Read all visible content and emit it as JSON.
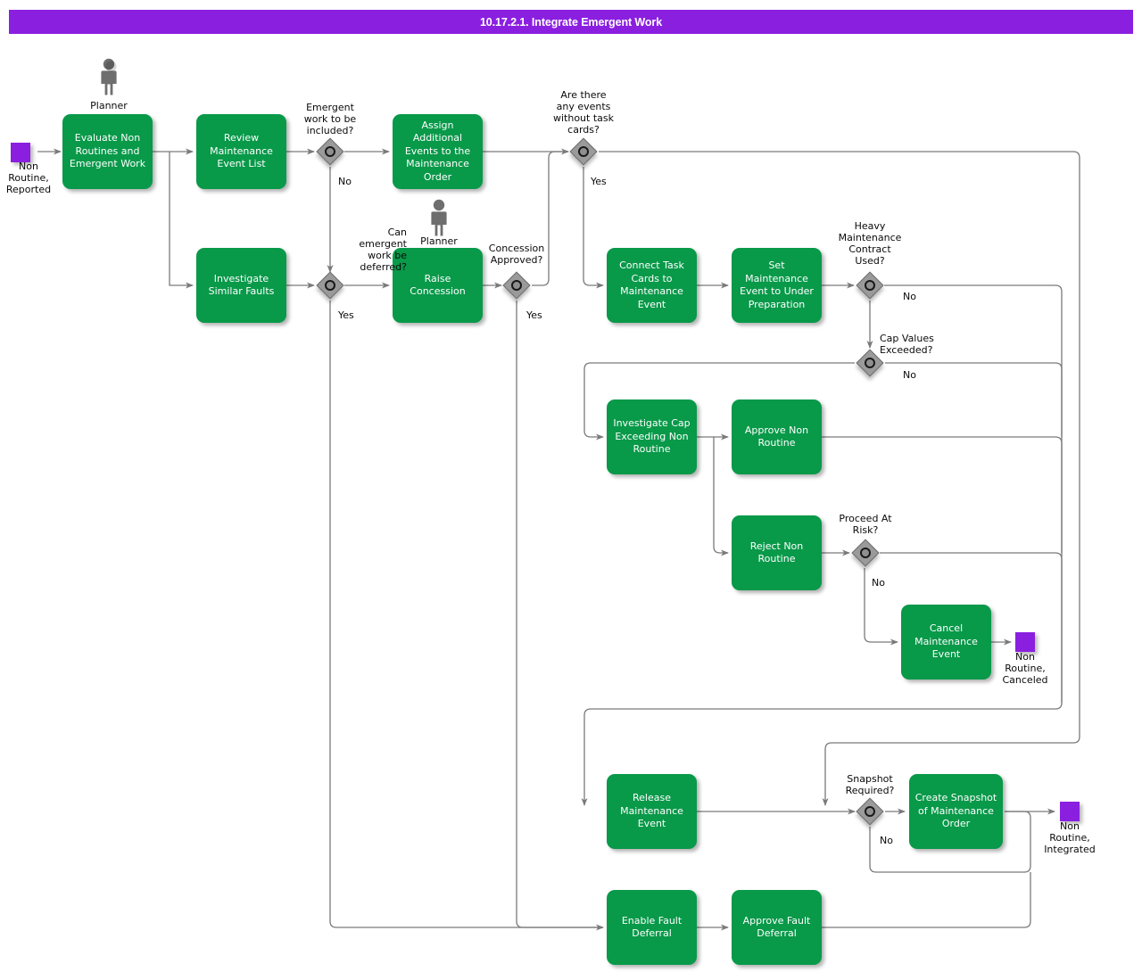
{
  "header": {
    "title": "10.17.2.1. Integrate Emergent Work",
    "bar_color": "#8A1FE0",
    "text_color": "#FFFFFF"
  },
  "theme": {
    "task_fill": "#089949",
    "task_text": "#FFFFFF",
    "gateway_fill": "#9A9A9A",
    "gateway_stroke": "#6D6D6D",
    "event_fill": "#8A1FE0",
    "connector_stroke": "#7A7A7A",
    "canvas_bg": "#FFFFFF",
    "actor_fill": "#6E6E6E"
  },
  "diagram": {
    "type": "bpmn-process-flow",
    "events": [
      {
        "id": "ev-start",
        "name": "start-event",
        "label": "Non\nRoutine,\nReported"
      },
      {
        "id": "ev-canceled",
        "name": "end-event-canceled",
        "label": "Non\nRoutine,\nCanceled"
      },
      {
        "id": "ev-integrated",
        "name": "end-event-integrated",
        "label": "Non\nRoutine,\nIntegrated"
      }
    ],
    "tasks": [
      {
        "id": "t-evaluate",
        "label": "Evaluate Non\nRoutines and\nEmergent Work"
      },
      {
        "id": "t-review",
        "label": "Review\nMaintenance\nEvent List"
      },
      {
        "id": "t-assign",
        "label": "Assign Additional\nEvents to the\nMaintenance\nOrder"
      },
      {
        "id": "t-investigate-faults",
        "label": "Investigate\nSimilar Faults"
      },
      {
        "id": "t-raise-concession",
        "label": "Raise\nConcession"
      },
      {
        "id": "t-connect-cards",
        "label": "Connect Task\nCards to\nMaintenance\nEvent"
      },
      {
        "id": "t-set-under-prep",
        "label": "Set\nMaintenance\nEvent to\nUnder\nPreparation"
      },
      {
        "id": "t-investigate-cap",
        "label": "Investigate Cap\nExceeding Non\nRoutine"
      },
      {
        "id": "t-approve-nonroutine",
        "label": "Approve Non\nRoutine"
      },
      {
        "id": "t-reject-nonroutine",
        "label": "Reject Non\nRoutine"
      },
      {
        "id": "t-cancel-event",
        "label": "Cancel\nMaintenance\nEvent"
      },
      {
        "id": "t-release-event",
        "label": "Release\nMaintenance\nEvent"
      },
      {
        "id": "t-create-snapshot",
        "label": "Create Snapshot\nof Maintenance\nOrder"
      },
      {
        "id": "t-enable-deferral",
        "label": "Enable Fault\nDeferral"
      },
      {
        "id": "t-approve-deferral",
        "label": "Approve Fault\nDeferral"
      }
    ],
    "gateways": [
      {
        "id": "gw-emergent-included",
        "label": "Emergent\nwork to be\nincluded?",
        "branch_label": "No"
      },
      {
        "id": "gw-can-defer",
        "label": "Can\nemergent\nwork be\ndeferred?",
        "branch_label": "Yes"
      },
      {
        "id": "gw-concession-approved",
        "label": "Concession\nApproved?",
        "branch_label": "Yes"
      },
      {
        "id": "gw-events-without-cards",
        "label": "Are there\nany events\nwithout task\ncards?",
        "branch_label": "Yes"
      },
      {
        "id": "gw-heavy-contract",
        "label": "Heavy\nMaintenance\nContract\nUsed?",
        "branch_label": "No"
      },
      {
        "id": "gw-cap-exceeded",
        "label": "Cap Values\nExceeded?",
        "branch_label": "No"
      },
      {
        "id": "gw-proceed-risk",
        "label": "Proceed At\nRisk?",
        "branch_label": "No"
      },
      {
        "id": "gw-snapshot-required",
        "label": "Snapshot\nRequired?",
        "branch_label": "No"
      }
    ],
    "actors": [
      {
        "id": "actor-planner-1",
        "label": "Planner"
      },
      {
        "id": "actor-planner-2",
        "label": "Planner"
      }
    ]
  }
}
